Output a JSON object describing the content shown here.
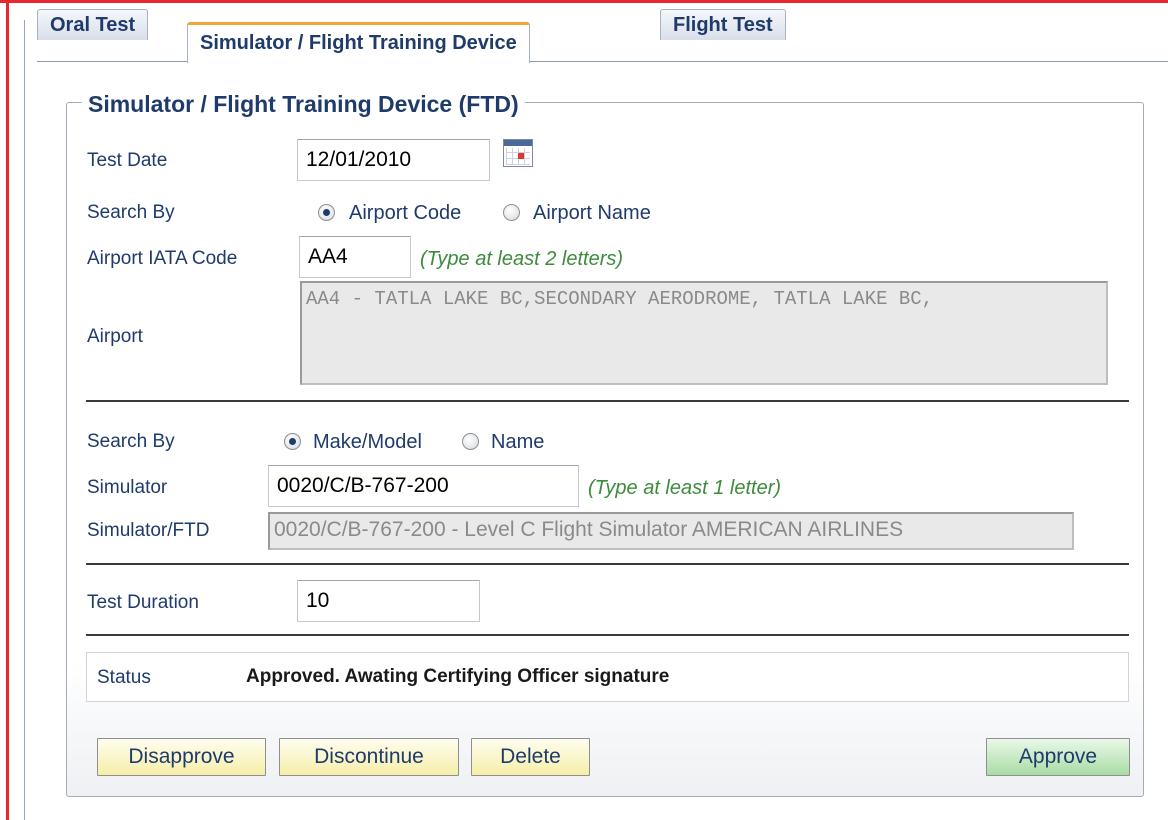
{
  "tabs": [
    {
      "label": "Oral Test"
    },
    {
      "label": "Simulator / Flight Training Device"
    },
    {
      "label": "Flight Test"
    }
  ],
  "active_tab": "Simulator / Flight Training Device",
  "panel": {
    "legend": "Simulator / Flight Training Device (FTD)"
  },
  "test_date": {
    "label": "Test Date",
    "value": "12/01/2010",
    "icon": "calendar-icon"
  },
  "airport_search": {
    "label": "Search By",
    "options": [
      {
        "label": "Airport Code",
        "checked": true
      },
      {
        "label": "Airport Name",
        "checked": false
      }
    ]
  },
  "airport_code": {
    "label": "Airport IATA Code",
    "value": "AA4",
    "hint": "(Type at least 2 letters)"
  },
  "airport": {
    "label": "Airport",
    "value": "AA4 - TATLA LAKE BC,SECONDARY AERODROME, TATLA LAKE BC,"
  },
  "sim_search": {
    "label": "Search By",
    "options": [
      {
        "label": "Make/Model",
        "checked": true
      },
      {
        "label": "Name",
        "checked": false
      }
    ]
  },
  "simulator": {
    "label": "Simulator",
    "value": "0020/C/B-767-200",
    "hint": "(Type at least 1 letter)"
  },
  "simulator_ftd": {
    "label": "Simulator/FTD",
    "value": "0020/C/B-767-200 - Level C Flight Simulator AMERICAN AIRLINES"
  },
  "test_duration": {
    "label": "Test Duration",
    "value": "10"
  },
  "status": {
    "label": "Status",
    "value": "Approved. Awating Certifying Officer signature"
  },
  "buttons": {
    "disapprove": "Disapprove",
    "discontinue": "Discontinue",
    "delete": "Delete",
    "approve": "Approve"
  },
  "colors": {
    "frame": "#e8262d",
    "label": "#1f3b6b",
    "hint": "#3c8c3c",
    "active_tab_accent": "#f0a632"
  }
}
